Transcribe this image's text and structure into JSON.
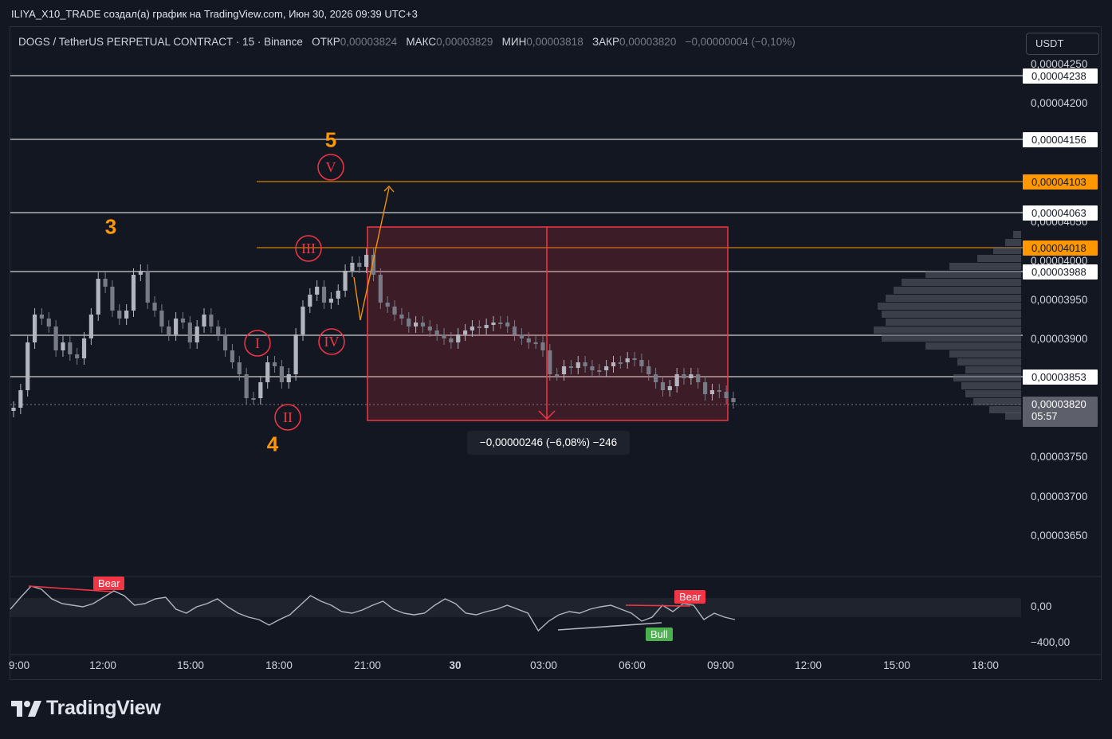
{
  "caption": "ILIYA_X10_TRADE создал(а) график на TradingView.com, Июн 30, 2026 09:39 UTC+3",
  "legend": {
    "symbol": "DOGS / TetherUS PERPETUAL CONTRACT · 15 · Binance",
    "open_label": "ОТКР",
    "open": "0,00003824",
    "high_label": "МАКС",
    "high": "0,00003829",
    "low_label": "МИН",
    "low": "0,00003818",
    "close_label": "ЗАКР",
    "close": "0,00003820",
    "change": "−0,00000004 (−0,10%)"
  },
  "currency_button": "USDT",
  "price_axis": {
    "ticks": [
      "0,00004250",
      "0,00004200",
      "0,00004050",
      "0,00004000",
      "0,00003950",
      "0,00003900",
      "0,00003750",
      "0,00003700",
      "0,00003650"
    ],
    "tagged_levels": [
      {
        "value": "0,00004238",
        "style": "white"
      },
      {
        "value": "0,00004156",
        "style": "white"
      },
      {
        "value": "0,00004103",
        "style": "orange"
      },
      {
        "value": "0,00004063",
        "style": "white"
      },
      {
        "value": "0,00004018",
        "style": "orange"
      },
      {
        "value": "0,00003988",
        "style": "white"
      },
      {
        "value": "0,00003853",
        "style": "white"
      }
    ],
    "current_price": "0,00003820",
    "countdown": "05:57"
  },
  "time_axis": {
    "labels": [
      {
        "text": "9:00",
        "bold": false
      },
      {
        "text": "12:00",
        "bold": false
      },
      {
        "text": "15:00",
        "bold": false
      },
      {
        "text": "18:00",
        "bold": false
      },
      {
        "text": "21:00",
        "bold": false
      },
      {
        "text": "30",
        "bold": true
      },
      {
        "text": "03:00",
        "bold": false
      },
      {
        "text": "06:00",
        "bold": false
      },
      {
        "text": "09:00",
        "bold": false
      },
      {
        "text": "12:00",
        "bold": false
      },
      {
        "text": "15:00",
        "bold": false
      },
      {
        "text": "18:00",
        "bold": false
      }
    ]
  },
  "measure": {
    "text": "−0,00000246 (−6,08%) −246"
  },
  "waves": {
    "major": [
      "3",
      "4",
      "5"
    ],
    "minor": [
      "I",
      "II",
      "III",
      "IV",
      "V"
    ]
  },
  "oscillator": {
    "axis": [
      "0,00",
      "−400,00"
    ],
    "tags": [
      "Bear",
      "Bear",
      "Bull"
    ]
  },
  "colors": {
    "background": "#131722",
    "bull": "#b2b5be",
    "bear": "#787b86",
    "orange": "#ff9800",
    "red": "#f23645",
    "zone": "rgba(242,54,69,0.18)"
  },
  "brand": "TradingView"
}
